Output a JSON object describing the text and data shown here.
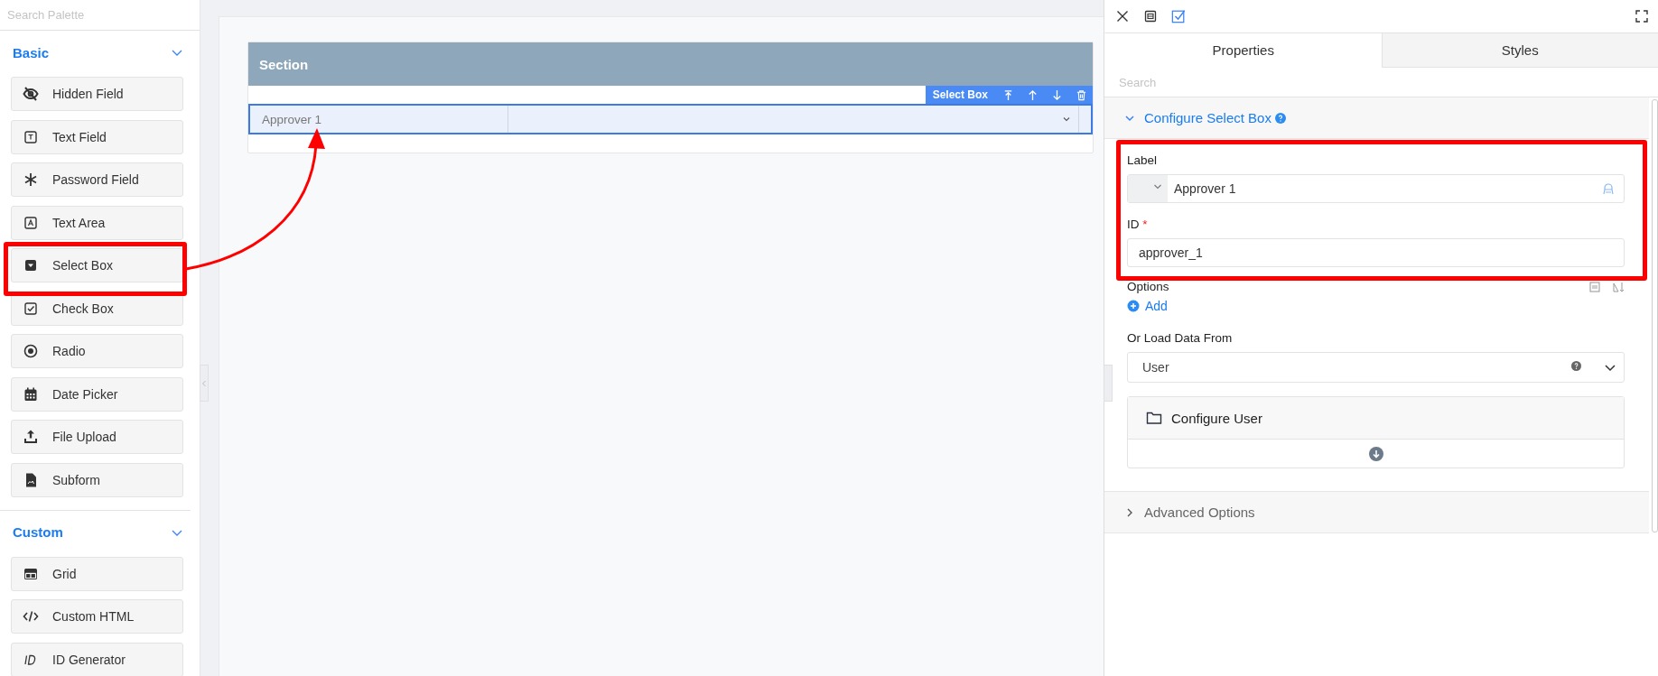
{
  "palette": {
    "search_placeholder": "Search Palette",
    "groups": [
      {
        "title": "Basic",
        "expanded": true,
        "items": [
          {
            "label": "Hidden Field",
            "kind": "hidden"
          },
          {
            "label": "Text Field",
            "kind": "text"
          },
          {
            "label": "Password Field",
            "kind": "password"
          },
          {
            "label": "Text Area",
            "kind": "textarea"
          },
          {
            "label": "Select Box",
            "kind": "select"
          },
          {
            "label": "Check Box",
            "kind": "checkbox"
          },
          {
            "label": "Radio",
            "kind": "radio"
          },
          {
            "label": "Date Picker",
            "kind": "date"
          },
          {
            "label": "File Upload",
            "kind": "upload"
          },
          {
            "label": "Subform",
            "kind": "subform"
          }
        ]
      },
      {
        "title": "Custom",
        "expanded": true,
        "items": [
          {
            "label": "Grid",
            "kind": "grid"
          },
          {
            "label": "Custom HTML",
            "kind": "html"
          },
          {
            "label": "ID Generator",
            "kind": "id"
          }
        ]
      }
    ]
  },
  "canvas": {
    "section_title": "Section",
    "toolbar_title": "Select Box",
    "field_label": "Approver 1",
    "selected": true
  },
  "properties": {
    "tabs": [
      {
        "label": "Properties",
        "selected": true
      },
      {
        "label": "Styles",
        "selected": false
      }
    ],
    "search_placeholder": "Search",
    "configure": {
      "title": "Configure Select Box",
      "expanded": true
    },
    "label_field": {
      "label": "Label",
      "value": "Approver 1"
    },
    "id_field": {
      "label": "ID",
      "required_mark": "*",
      "value": "approver_1"
    },
    "options_label": "Options",
    "add_label": "Add",
    "load_label": "Or Load Data From",
    "load_value": "User",
    "configure_user": "Configure User",
    "advanced": {
      "title": "Advanced Options",
      "expanded": false
    }
  }
}
